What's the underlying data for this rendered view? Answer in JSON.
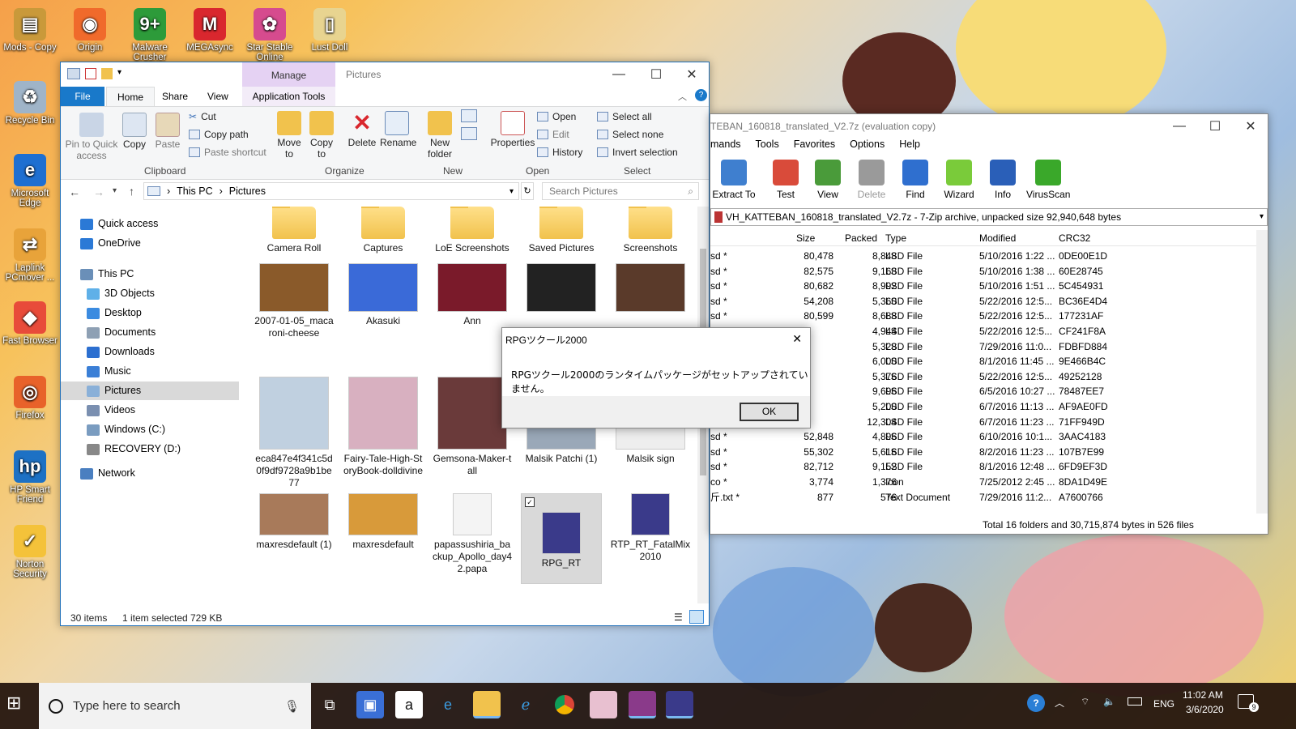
{
  "desktop": {
    "icons": [
      {
        "label": "Mods - Copy",
        "color": "#c9993a",
        "glyph": "▤"
      },
      {
        "label": "Origin",
        "color": "#f06a2b",
        "glyph": "◉"
      },
      {
        "label": "Malware Crusher",
        "color": "#2d9b3a",
        "glyph": "9+"
      },
      {
        "label": "MEGAsync",
        "color": "#d9272e",
        "glyph": "M"
      },
      {
        "label": "Star Stable Online",
        "color": "#d64b8e",
        "glyph": "✿"
      },
      {
        "label": "Lust Doll",
        "color": "#e8d490",
        "glyph": "▯"
      },
      {
        "label": "Recycle Bin",
        "color": "#9fb4c8",
        "glyph": "♻"
      },
      {
        "label": "Microsoft Edge",
        "color": "#1e6fd1",
        "glyph": "e"
      },
      {
        "label": "Laplink PCmover ...",
        "color": "#e8a33a",
        "glyph": "⇄"
      },
      {
        "label": "Fast Browser",
        "color": "#e84b3a",
        "glyph": "◆"
      },
      {
        "label": "Firefox",
        "color": "#e8622a",
        "glyph": "◎"
      },
      {
        "label": "HP Smart Friend",
        "color": "#1d71c4",
        "glyph": "hp"
      },
      {
        "label": "Norton Security",
        "color": "#f4c23a",
        "glyph": "✓"
      }
    ]
  },
  "explorer": {
    "quick_access_toolbar": "",
    "contextual_tab": "Manage",
    "title": "Pictures",
    "tabs": [
      "File",
      "Home",
      "Share",
      "View",
      "Application Tools"
    ],
    "clipboard": {
      "pin": "Pin to Quick access",
      "copy": "Copy",
      "paste": "Paste",
      "cut": "Cut",
      "copy_path": "Copy path",
      "paste_shortcut": "Paste shortcut",
      "label": "Clipboard"
    },
    "organize": {
      "move_to": "Move to",
      "copy_to": "Copy to",
      "delete": "Delete",
      "rename": "Rename",
      "label": "Organize"
    },
    "new": {
      "new_folder": "New folder",
      "label": "New"
    },
    "open": {
      "properties": "Properties",
      "open": "Open",
      "edit": "Edit",
      "history": "History",
      "label": "Open"
    },
    "select": {
      "select_all": "Select all",
      "select_none": "Select none",
      "invert": "Invert selection",
      "label": "Select"
    },
    "address": [
      "This PC",
      "Pictures"
    ],
    "search_placeholder": "Search Pictures",
    "nav": [
      {
        "label": "Quick access",
        "color": "#2b79d6",
        "indent": 0
      },
      {
        "label": "OneDrive",
        "color": "#2b79d6",
        "indent": 0
      },
      {
        "label": "This PC",
        "color": "#6a8fb8",
        "indent": 0
      },
      {
        "label": "3D Objects",
        "color": "#5fb0e8",
        "indent": 1
      },
      {
        "label": "Desktop",
        "color": "#3b8be0",
        "indent": 1
      },
      {
        "label": "Documents",
        "color": "#8ea0b4",
        "indent": 1
      },
      {
        "label": "Downloads",
        "color": "#2c6fd0",
        "indent": 1
      },
      {
        "label": "Music",
        "color": "#3b7fd6",
        "indent": 1
      },
      {
        "label": "Pictures",
        "color": "#8ab0d8",
        "indent": 1
      },
      {
        "label": "Videos",
        "color": "#7a8fb0",
        "indent": 1
      },
      {
        "label": "Windows (C:)",
        "color": "#7a9cc0",
        "indent": 1
      },
      {
        "label": "RECOVERY (D:)",
        "color": "#888",
        "indent": 1
      },
      {
        "label": "Network",
        "color": "#4a7fc0",
        "indent": 0
      }
    ],
    "files_row0": [
      "Camera Roll",
      "Captures",
      "LoE Screenshots",
      "Saved Pictures",
      "Screenshots"
    ],
    "files_row1": [
      "2007-01-05_macaroni-cheese",
      "Akasuki",
      "Ann",
      "",
      ""
    ],
    "files_row2": [
      "eca847e4f341c5d0f9df9728a9b1be77",
      "Fairy-Tale-High-StoryBook-dolldivine",
      "Gemsona-Maker-tall",
      "Malsik Patchi (1)",
      "Malsik sign"
    ],
    "files_row3": [
      "maxresdefault (1)",
      "maxresdefault",
      "papassushiria_backup_Apollo_day42.papa",
      "RPG_RT",
      "RTP_RT_FatalMix2010"
    ],
    "status_items": "30 items",
    "status_selected": "1 item selected",
    "status_size": "729 KB"
  },
  "sevenzip": {
    "title": "TEBAN_160818_translated_V2.7z (evaluation copy)",
    "menu": [
      "mands",
      "Tools",
      "Favorites",
      "Options",
      "Help"
    ],
    "toolbar": [
      {
        "label": "Extract To",
        "color": "#3f7fcf"
      },
      {
        "label": "Test",
        "color": "#d94b3a"
      },
      {
        "label": "View",
        "color": "#4a9b3a"
      },
      {
        "label": "Delete",
        "color": "#9a9a9a"
      },
      {
        "label": "Find",
        "color": "#2f6fcf"
      },
      {
        "label": "Wizard",
        "color": "#7acb3a"
      },
      {
        "label": "Info",
        "color": "#2a5fb8"
      },
      {
        "label": "VirusScan",
        "color": "#3aa82a"
      }
    ],
    "path": "VH_KATTEBAN_160818_translated_V2.7z - 7-Zip archive, unpacked size 92,940,648 bytes",
    "columns": [
      "Size",
      "Packed",
      "Type",
      "Modified",
      "CRC32"
    ],
    "rows": [
      [
        "sd *",
        "80,478",
        "8,848",
        "LSD File",
        "5/10/2016 1:22 ...",
        "0DE00E1D"
      ],
      [
        "sd *",
        "82,575",
        "9,168",
        "LSD File",
        "5/10/2016 1:38 ...",
        "60E28745"
      ],
      [
        "sd *",
        "80,682",
        "8,992",
        "LSD File",
        "5/10/2016 1:51 ...",
        "5C454931"
      ],
      [
        "sd *",
        "54,208",
        "5,360",
        "LSD File",
        "5/22/2016 12:5...",
        "BC36E4D4"
      ],
      [
        "sd *",
        "80,599",
        "8,688",
        "LSD File",
        "5/22/2016 12:5...",
        "177231AF"
      ],
      [
        "",
        "",
        "4,944",
        "LSD File",
        "5/22/2016 12:5...",
        "CF241F8A"
      ],
      [
        "",
        "",
        "5,328",
        "LSD File",
        "7/29/2016 11:0...",
        "FDBFD884"
      ],
      [
        "",
        "",
        "6,000",
        "LSD File",
        "8/1/2016 11:45 ...",
        "9E466B4C"
      ],
      [
        "",
        "",
        "5,376",
        "LSD File",
        "5/22/2016 12:5...",
        "49252128"
      ],
      [
        "",
        "",
        "9,696",
        "LSD File",
        "6/5/2016 10:27 ...",
        "78487EE7"
      ],
      [
        "",
        "",
        "5,200",
        "LSD File",
        "6/7/2016 11:13 ...",
        "AF9AE0FD"
      ],
      [
        "",
        "",
        "12,304",
        "LSD File",
        "6/7/2016 11:23 ...",
        "71FF949D"
      ],
      [
        "sd *",
        "52,848",
        "4,896",
        "LSD File",
        "6/10/2016 10:1...",
        "3AAC4183"
      ],
      [
        "sd *",
        "55,302",
        "5,616",
        "LSD File",
        "8/2/2016 11:23 ...",
        "107B7E99"
      ],
      [
        "sd *",
        "82,712",
        "9,152",
        "LSD File",
        "8/1/2016 12:48 ...",
        "6FD9EF3D"
      ],
      [
        "co *",
        "3,774",
        "1,376",
        "Icon",
        "7/25/2012 2:45 ...",
        "8DA1D49E"
      ],
      [
        "斤.txt *",
        "877",
        "576",
        "Text Document",
        "7/29/2016 11:2...",
        "A7600766"
      ]
    ],
    "status": "Total 16 folders and 30,715,874 bytes in 526 files"
  },
  "dialog": {
    "title": "RPGツクール2000",
    "message": "RPGツクール2000のランタイムパッケージがセットアップされていません。",
    "ok": "OK"
  },
  "taskbar": {
    "search_placeholder": "Type here to search",
    "lang": "ENG",
    "time": "11:02 AM",
    "date": "3/6/2020",
    "notif_count": "9"
  }
}
